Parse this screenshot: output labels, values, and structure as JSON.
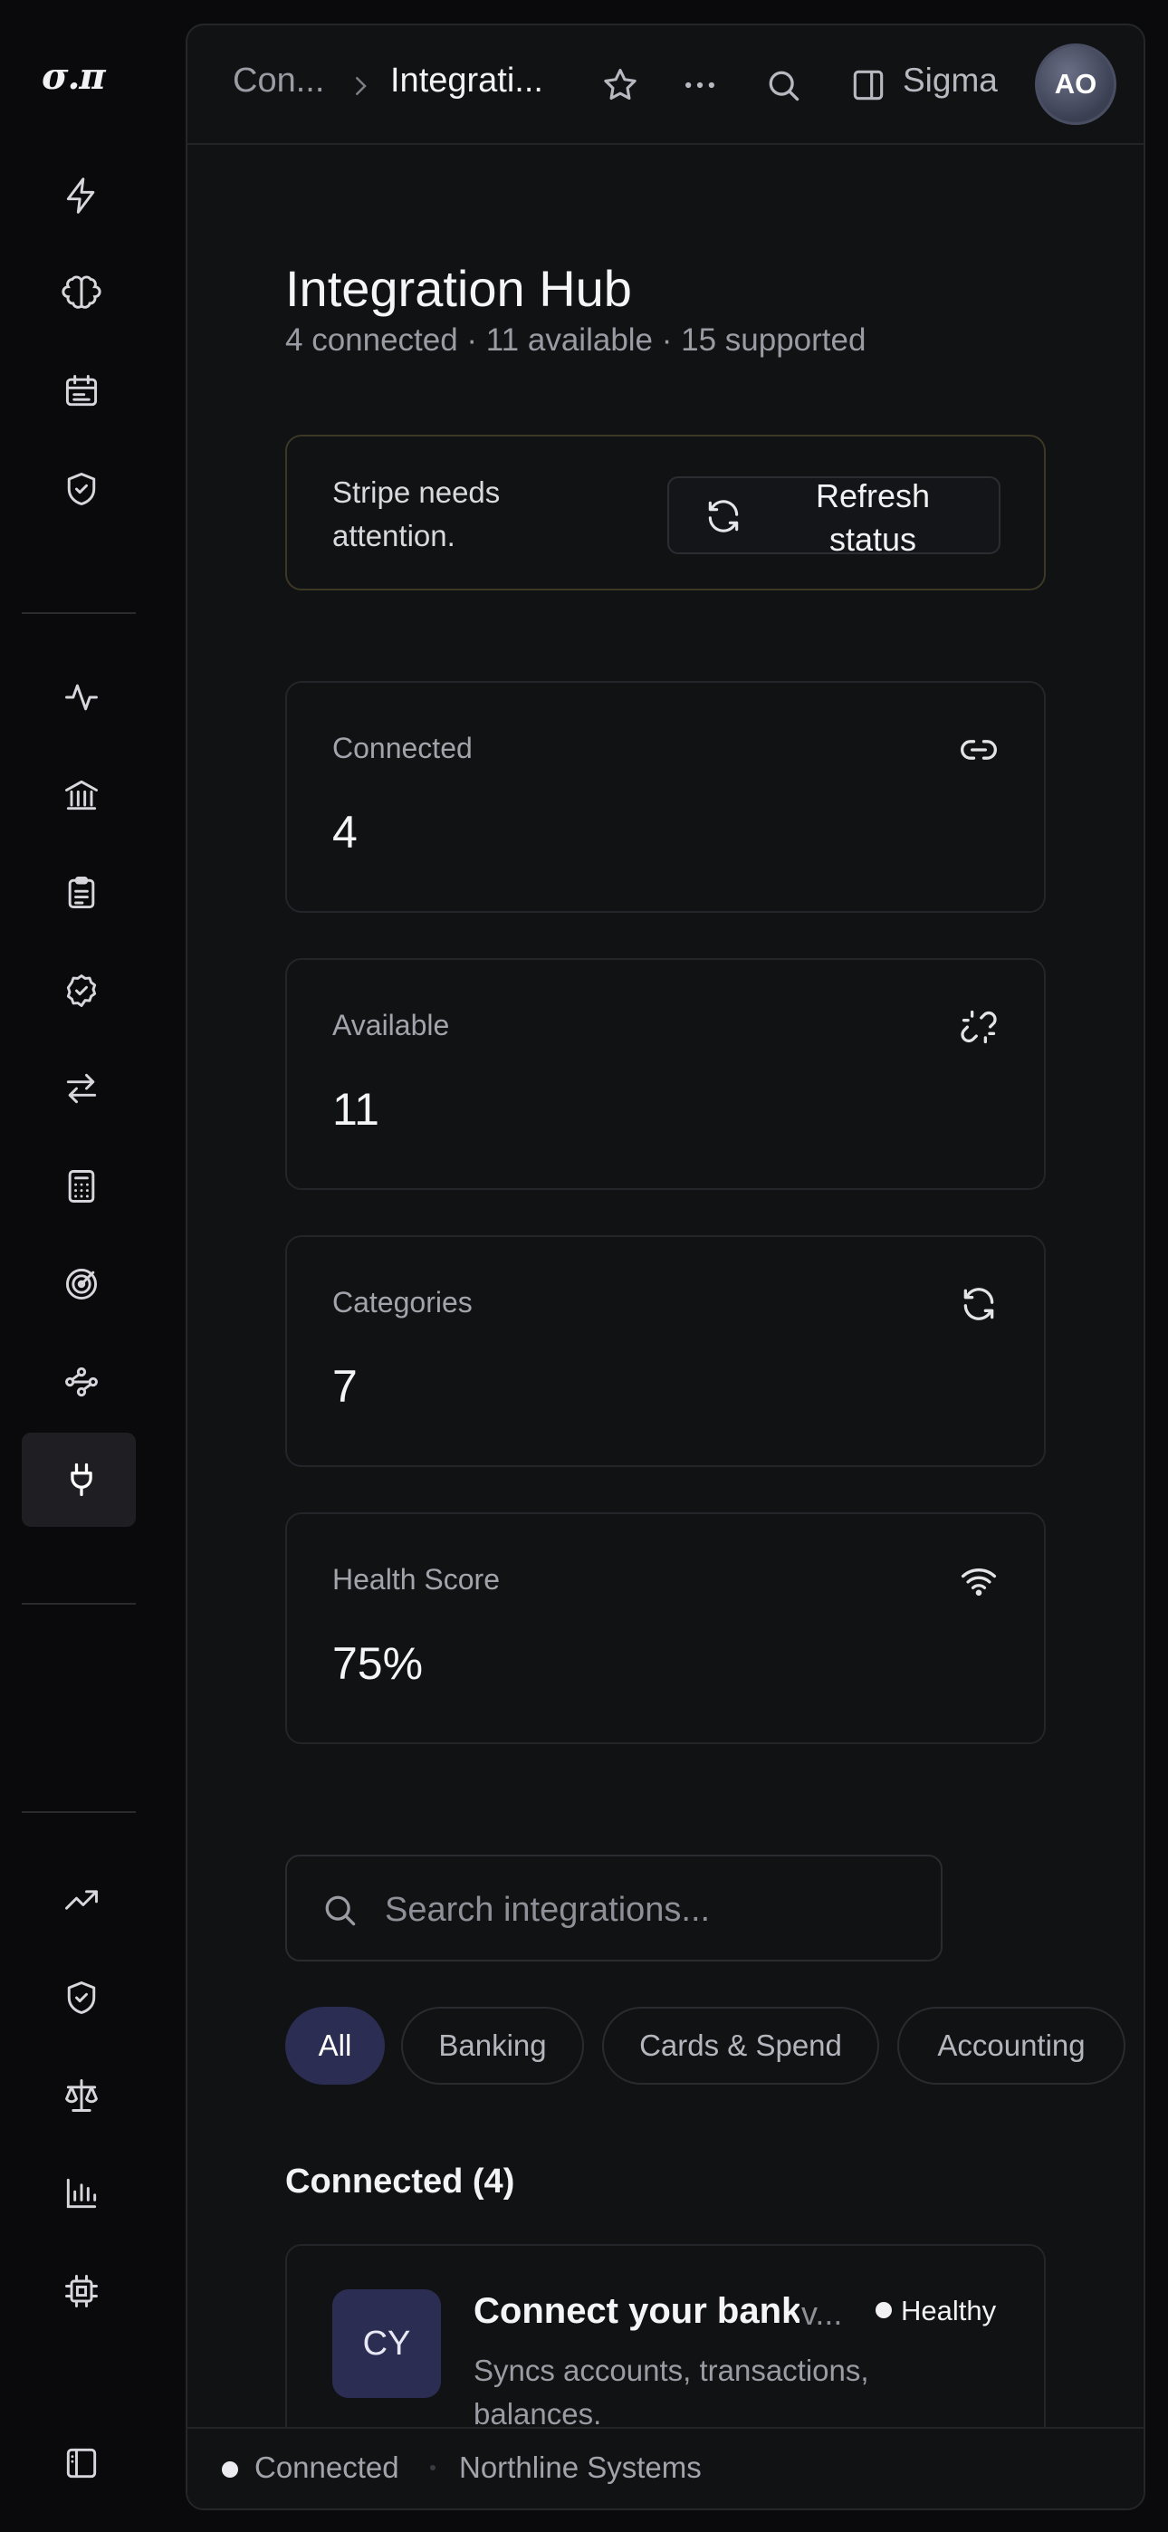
{
  "app": {
    "logo_text": "σ.π"
  },
  "sidebar": {
    "group1": [
      {
        "icon": "lightning-icon"
      },
      {
        "icon": "brain-icon"
      },
      {
        "icon": "calendar-icon"
      },
      {
        "icon": "shield-check-icon"
      }
    ],
    "group2": [
      {
        "icon": "activity-icon"
      },
      {
        "icon": "bank-icon"
      },
      {
        "icon": "clipboard-icon"
      },
      {
        "icon": "badge-check-icon"
      },
      {
        "icon": "transfer-arrows-icon"
      },
      {
        "icon": "calculator-icon"
      },
      {
        "icon": "target-icon"
      },
      {
        "icon": "workflow-icon"
      },
      {
        "icon": "plug-icon",
        "active": true
      }
    ],
    "group3": [
      {
        "icon": "trending-up-icon"
      },
      {
        "icon": "shield-check-icon"
      },
      {
        "icon": "scale-icon"
      },
      {
        "icon": "bar-chart-icon"
      },
      {
        "icon": "cpu-icon"
      }
    ],
    "footer": {
      "icon": "sidebar-toggle-icon"
    }
  },
  "topbar": {
    "breadcrumb_parent": "Con...",
    "breadcrumb_current": "Integrati...",
    "layout_label": "Sigma",
    "avatar_initials": "AO"
  },
  "page": {
    "title": "Integration Hub",
    "subtitle": "4 connected · 11 available · 15 supported"
  },
  "alert": {
    "text": "Stripe needs attention.",
    "button_label": "Refresh status",
    "border_color": "#3d3826"
  },
  "stats": [
    {
      "label": "Connected",
      "value": "4",
      "icon": "link-icon"
    },
    {
      "label": "Available",
      "value": "11",
      "icon": "broken-link-icon"
    },
    {
      "label": "Categories",
      "value": "7",
      "icon": "refresh-icon"
    },
    {
      "label": "Health Score",
      "value": "75%",
      "icon": "wifi-icon"
    }
  ],
  "search": {
    "placeholder": "Search integrations...",
    "value": ""
  },
  "filters": [
    {
      "label": "All",
      "active": true
    },
    {
      "label": "Banking"
    },
    {
      "label": "Cards & Spend"
    },
    {
      "label": "Accounting"
    }
  ],
  "connected_section": {
    "title": "Connected (4)",
    "items": [
      {
        "logo": "CY",
        "name": "Connect your bank",
        "version": "v...",
        "status": "Healthy",
        "description": "Syncs accounts, transactions, balances."
      }
    ]
  },
  "statusbar": {
    "connection": "Connected",
    "organization": "Northline Systems"
  },
  "colors": {
    "accent": "#2b2d52",
    "background": "#0a0a0c",
    "panel": "#111214"
  }
}
